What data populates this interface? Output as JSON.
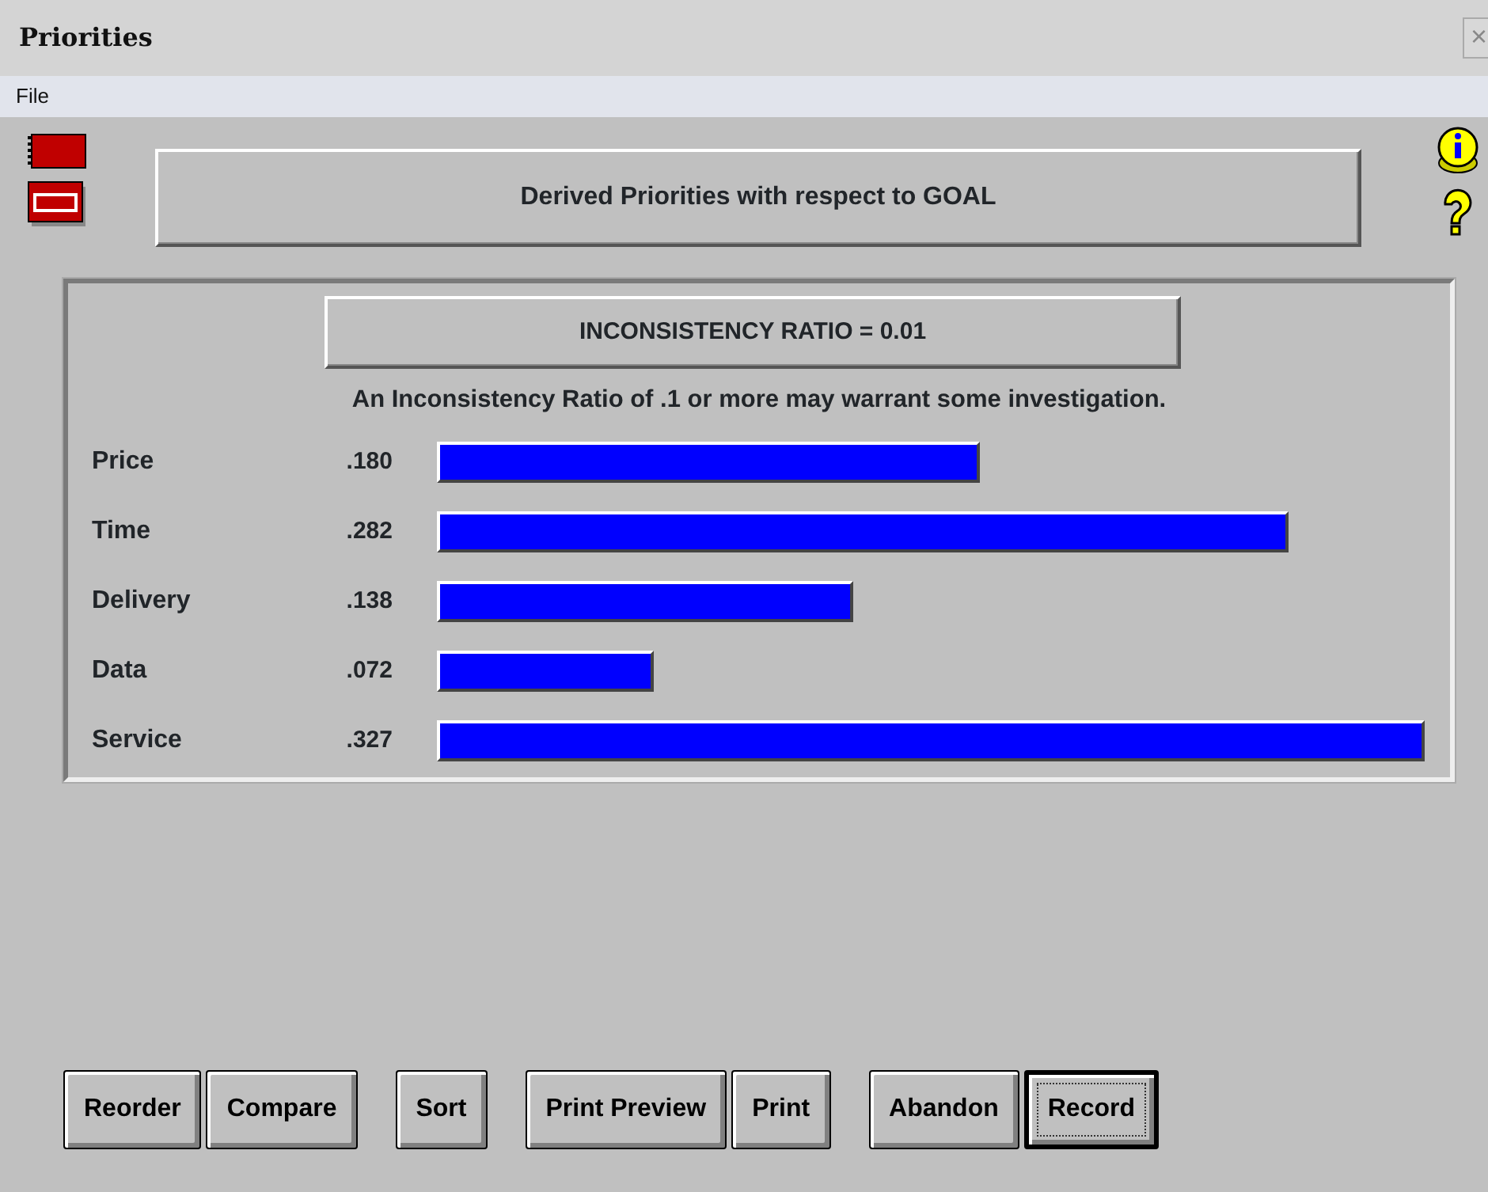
{
  "window": {
    "title": "Priorities",
    "close": "×"
  },
  "menu": [
    "File"
  ],
  "header": "Derived Priorities with respect to GOAL",
  "inconsistency": "INCONSISTENCY RATIO = 0.01",
  "note": "An Inconsistency Ratio of .1 or more may warrant some investigation.",
  "priorities": [
    {
      "name": "Price",
      "value": ".180"
    },
    {
      "name": "Time",
      "value": ".282"
    },
    {
      "name": "Delivery",
      "value": ".138"
    },
    {
      "name": "Data",
      "value": ".072"
    },
    {
      "name": "Service",
      "value": ".327"
    }
  ],
  "button_groups": [
    [
      {
        "label": "Reorder",
        "default": false
      },
      {
        "label": "Compare",
        "default": false
      }
    ],
    [
      {
        "label": "Sort",
        "default": false
      }
    ],
    [
      {
        "label": "Print Preview",
        "default": false
      },
      {
        "label": "Print",
        "default": false
      }
    ],
    [
      {
        "label": "Abandon",
        "default": false
      },
      {
        "label": "Record",
        "default": true
      }
    ]
  ]
}
